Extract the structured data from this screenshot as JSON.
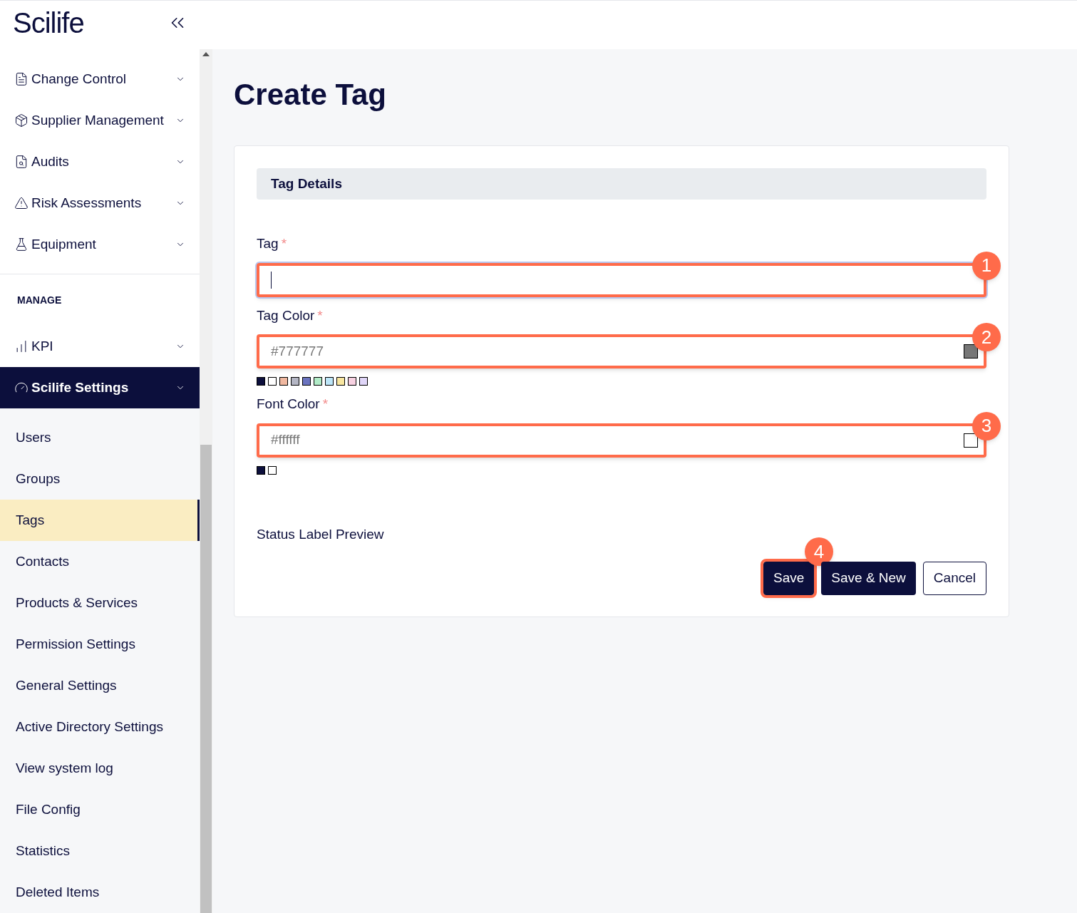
{
  "logo": "Scilife",
  "sidebar": {
    "modules": [
      {
        "label": "Change Control",
        "selected": false
      },
      {
        "label": "Supplier Management",
        "selected": false
      },
      {
        "label": "Audits",
        "selected": false
      },
      {
        "label": "Risk Assessments",
        "selected": false
      },
      {
        "label": "Equipment",
        "selected": false
      }
    ],
    "manage_heading": "MANAGE",
    "manage": [
      {
        "label": "KPI",
        "selected": false
      },
      {
        "label": "Scilife Settings",
        "selected": true
      }
    ],
    "settings_items": [
      {
        "label": "Users",
        "selected": false
      },
      {
        "label": "Groups",
        "selected": false
      },
      {
        "label": "Tags",
        "selected": true
      },
      {
        "label": "Contacts",
        "selected": false
      },
      {
        "label": "Products & Services",
        "selected": false
      },
      {
        "label": "Permission Settings",
        "selected": false
      },
      {
        "label": "General Settings",
        "selected": false
      },
      {
        "label": "Active Directory Settings",
        "selected": false
      },
      {
        "label": "View system log",
        "selected": false
      },
      {
        "label": "File Config",
        "selected": false
      },
      {
        "label": "Statistics",
        "selected": false
      },
      {
        "label": "Deleted Items",
        "selected": false
      }
    ]
  },
  "page_title": "Create Tag",
  "section_title": "Tag Details",
  "fields": [
    {
      "label": "Tag",
      "required_mark": "*",
      "kind": "text",
      "annotation": "1"
    },
    {
      "label": "Tag Color",
      "required_mark": "*",
      "kind": "color",
      "placeholder": "#777777",
      "color": "#777777",
      "annotation": "2",
      "swatches": [
        {
          "color": "#0c0f3c"
        },
        {
          "color": "#ffffff"
        },
        {
          "color": "#f0b8a0"
        },
        {
          "color": "#b4b6c4"
        },
        {
          "color": "#6b74c0"
        },
        {
          "color": "#b2ecc8"
        },
        {
          "color": "#bde6f8"
        },
        {
          "color": "#f8e6a0"
        },
        {
          "color": "#f8d2e2"
        },
        {
          "color": "#e0d6f8"
        }
      ]
    },
    {
      "label": "Font Color",
      "required_mark": "*",
      "kind": "color",
      "placeholder": "#ffffff",
      "color": "#ffffff",
      "annotation": "3",
      "swatches": [
        {
          "color": "#0c0f3c"
        },
        {
          "color": "#ffffff"
        }
      ]
    }
  ],
  "preview_label": "Status Label Preview",
  "buttons": [
    {
      "label": "Save",
      "kind": "primary",
      "annotation": "4"
    },
    {
      "label": "Save & New",
      "kind": "primary"
    },
    {
      "label": "Cancel",
      "kind": "secondary"
    }
  ]
}
